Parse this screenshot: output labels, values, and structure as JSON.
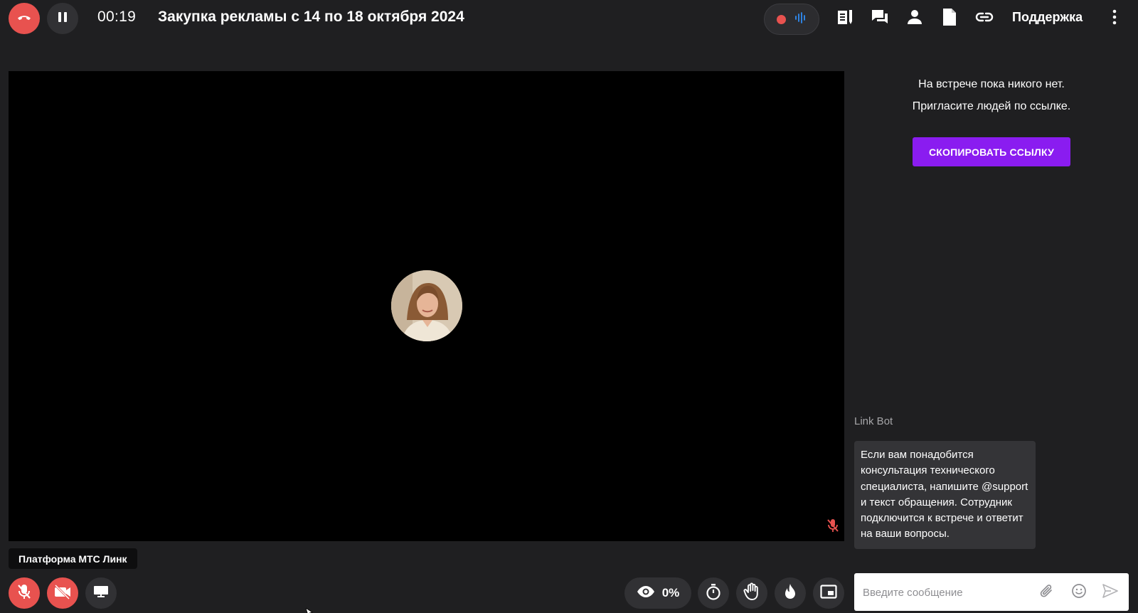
{
  "header": {
    "timer": "00:19",
    "meeting_title": "Закупка рекламы с 14 по 18 октября 2024",
    "support_label": "Поддержка",
    "icons": [
      "hang-up-icon",
      "pause-icon",
      "record-icon",
      "audio-wave-icon",
      "notes-icon",
      "chat-icon",
      "person-icon",
      "document-icon",
      "link-icon",
      "more-vertical-icon"
    ]
  },
  "stage": {
    "participant_label": "Платформа МТС Линк",
    "avatar_icon": "participant-avatar",
    "muted_icon": "mic-off-icon"
  },
  "controls": {
    "views_percent": "0%",
    "icons": [
      "mic-off-icon",
      "camera-off-icon",
      "screen-share-icon",
      "eye-icon",
      "timer-icon",
      "raise-hand-icon",
      "fire-icon",
      "picture-in-picture-icon"
    ]
  },
  "panel": {
    "empty_line1": "На встрече пока никого нет.",
    "empty_line2": "Пригласите людей по ссылке.",
    "copy_link_label": "СКОПИРОВАТЬ ССЫЛКУ",
    "bot_name": "Link Bot",
    "bot_message": "Если вам понадобится консультация технического специалиста, напишите @support и текст обращения. Сотрудник подключится к встрече и ответит на ваши вопросы.",
    "input_placeholder": "Введите сообщение",
    "icons": [
      "attach-icon",
      "emoji-icon",
      "send-icon"
    ]
  },
  "colors": {
    "background": "#1f1f21",
    "danger": "#e8524f",
    "accent": "#8a1cf0",
    "audio_wave": "#2f8cf5"
  }
}
